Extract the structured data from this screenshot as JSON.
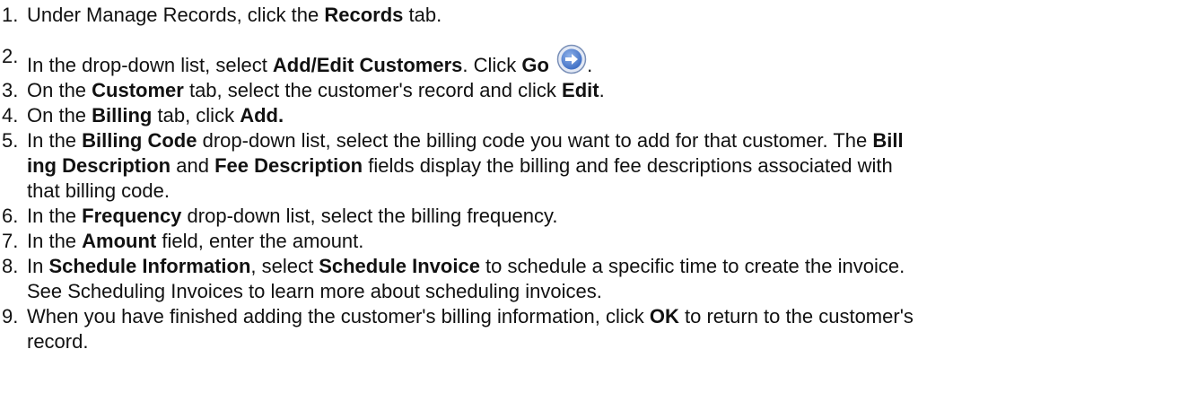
{
  "steps": [
    {
      "num": "1.",
      "segments": [
        {
          "t": "Under Manage Records, click the "
        },
        {
          "t": "Records",
          "b": true
        },
        {
          "t": " tab."
        }
      ]
    },
    {
      "num": "2.",
      "segments": [
        {
          "t": "In the drop-down list, select "
        },
        {
          "t": "Add/Edit Customers",
          "b": true
        },
        {
          "t": ". Click "
        },
        {
          "t": "Go",
          "b": true
        },
        {
          "t": " "
        },
        {
          "icon": "go-arrow-icon"
        },
        {
          "t": "."
        }
      ]
    },
    {
      "num": "3.",
      "segments": [
        {
          "t": "On the "
        },
        {
          "t": "Customer",
          "b": true
        },
        {
          "t": " tab, select the customer's record and click "
        },
        {
          "t": "Edit",
          "b": true
        },
        {
          "t": "."
        }
      ]
    },
    {
      "num": "4.",
      "segments": [
        {
          "t": "On the "
        },
        {
          "t": "Billing",
          "b": true
        },
        {
          "t": " tab, click "
        },
        {
          "t": "Add.",
          "b": true
        }
      ]
    },
    {
      "num": "5.",
      "segments": [
        {
          "t": "In the "
        },
        {
          "t": "Billing Code",
          "b": true
        },
        {
          "t": " drop-down list, select the billing code you want to add for that customer. The "
        },
        {
          "t": "Bill",
          "b": true
        },
        {
          "br": true
        },
        {
          "t": "ing Description",
          "b": true
        },
        {
          "t": " and "
        },
        {
          "t": "Fee Description",
          "b": true
        },
        {
          "t": " fields display the billing and fee descriptions associated with"
        },
        {
          "br": true
        },
        {
          "t": "that billing code."
        }
      ]
    },
    {
      "num": "6.",
      "segments": [
        {
          "t": "In the "
        },
        {
          "t": "Frequency",
          "b": true
        },
        {
          "t": " drop-down list, select the billing frequency."
        }
      ]
    },
    {
      "num": "7.",
      "segments": [
        {
          "t": "In the "
        },
        {
          "t": "Amount",
          "b": true
        },
        {
          "t": " field, enter the amount."
        }
      ]
    },
    {
      "num": "8.",
      "segments": [
        {
          "t": "In "
        },
        {
          "t": "Schedule Information",
          "b": true
        },
        {
          "t": ", select "
        },
        {
          "t": "Schedule Invoice",
          "b": true
        },
        {
          "t": " to schedule a specific time to create the invoice."
        },
        {
          "br": true
        },
        {
          "t": "See Scheduling Invoices to learn more about scheduling invoices."
        }
      ]
    },
    {
      "num": "9.",
      "segments": [
        {
          "t": "When you have finished adding the customer's billing information, click "
        },
        {
          "t": "OK",
          "b": true
        },
        {
          "t": " to return to the customer's"
        },
        {
          "br": true
        },
        {
          "t": "record."
        }
      ]
    }
  ],
  "colors": {
    "text": "#111111",
    "icon_ring": "#7a90b8",
    "icon_fill": "#3f6fc4",
    "icon_arrow": "#ffffff"
  }
}
